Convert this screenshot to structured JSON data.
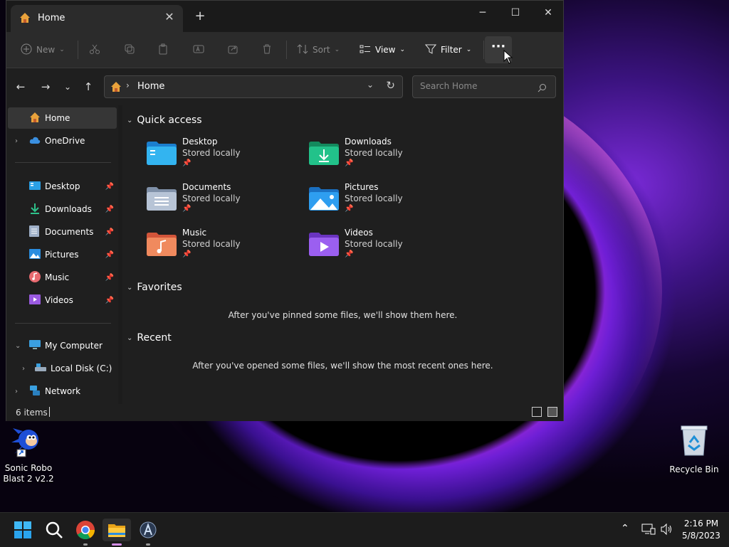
{
  "window": {
    "tab_title": "Home",
    "new_tab": "+",
    "minimize": "─",
    "maximize": "☐",
    "close": "✕",
    "tab_close": "✕"
  },
  "toolbar": {
    "new_label": "New",
    "sort_label": "Sort",
    "view_label": "View",
    "filter_label": "Filter",
    "more_label": "···"
  },
  "address": {
    "path": "Home",
    "search_placeholder": "Search Home"
  },
  "sidebar": {
    "home": "Home",
    "onedrive": "OneDrive",
    "pinned": [
      {
        "label": "Desktop",
        "icon": "desktop-icon"
      },
      {
        "label": "Downloads",
        "icon": "download-icon"
      },
      {
        "label": "Documents",
        "icon": "document-icon"
      },
      {
        "label": "Pictures",
        "icon": "picture-icon"
      },
      {
        "label": "Music",
        "icon": "music-icon"
      },
      {
        "label": "Videos",
        "icon": "video-icon"
      }
    ],
    "my_computer": "My Computer",
    "local_disk": "Local Disk (C:)",
    "network": "Network"
  },
  "main": {
    "quick_access_title": "Quick access",
    "quick_access": [
      {
        "name": "Desktop",
        "sub": "Stored locally"
      },
      {
        "name": "Downloads",
        "sub": "Stored locally"
      },
      {
        "name": "Documents",
        "sub": "Stored locally"
      },
      {
        "name": "Pictures",
        "sub": "Stored locally"
      },
      {
        "name": "Music",
        "sub": "Stored locally"
      },
      {
        "name": "Videos",
        "sub": "Stored locally"
      }
    ],
    "favorites_title": "Favorites",
    "favorites_empty": "After you've pinned some files, we'll show them here.",
    "recent_title": "Recent",
    "recent_empty": "After you've opened some files, we'll show the most recent ones here."
  },
  "status": {
    "item_count": "6 items"
  },
  "desktop": {
    "sonic_label": "Sonic Robo Blast 2 v2.2",
    "recycle_label": "Recycle Bin"
  },
  "taskbar": {
    "time": "2:16 PM",
    "date": "5/8/2023"
  }
}
